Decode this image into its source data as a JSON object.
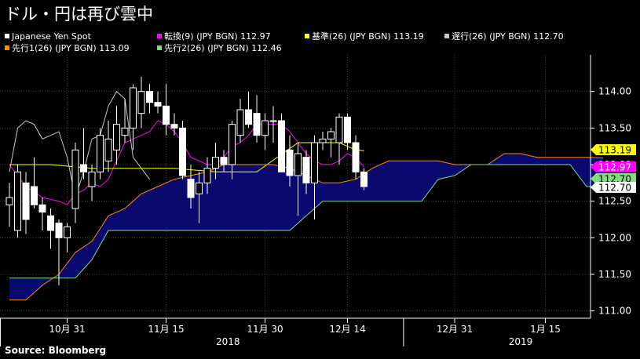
{
  "title": "ドル・円は再び雲中",
  "source": "Source: Bloomberg",
  "legend": [
    {
      "key": "spot",
      "label": "Japanese Yen Spot",
      "color": "#ffffff"
    },
    {
      "key": "tenkan",
      "label": "転換(9) (JPY BGN)    112.97",
      "color": "#ff00ff"
    },
    {
      "key": "kijun",
      "label": "基準(26) (JPY BGN) 113.19",
      "color": "#ffff00"
    },
    {
      "key": "chikou",
      "label": "遅行(26) (JPY BGN) 112.70",
      "color": "#c8c8c8"
    },
    {
      "key": "senkou1",
      "label": "先行1(26) (JPY BGN) 113.09",
      "color": "#ff8c00"
    },
    {
      "key": "senkou2",
      "label": "先行2(26) (JPY BGN) 112.46",
      "color": "#7fdc7f"
    }
  ],
  "chart_data": {
    "type": "candlestick",
    "title": "ドル・円は再び雲中",
    "ylim": [
      110.9,
      114.5
    ],
    "y_ticks": [
      "111.00",
      "111.50",
      "112.00",
      "112.50",
      "113.00",
      "113.50",
      "114.00"
    ],
    "x_tick_labels": [
      "10月 31",
      "11月 15",
      "11月 30",
      "12月 14",
      "12月 31",
      "1月 15"
    ],
    "x_period_labels": [
      "2018",
      "2019"
    ],
    "cloud_color": "#0a0a6e",
    "last_value_tags": [
      {
        "series": "kijun",
        "value": "113.19",
        "bg": "#ffff00",
        "fg": "#000000"
      },
      {
        "series": "tenkan",
        "value": "112.97",
        "bg": "#ff00ff",
        "fg": "#ffffff"
      },
      {
        "series": "senkou2",
        "value": "112.70",
        "bg": "#7fdc7f",
        "fg": "#000000"
      },
      {
        "series": "chikou",
        "value": "112.70",
        "bg": "#ffffff",
        "fg": "#000000"
      }
    ],
    "candles": [
      {
        "i": 0,
        "o": 112.45,
        "h": 112.75,
        "l": 112.15,
        "c": 112.55
      },
      {
        "i": 1,
        "o": 112.1,
        "h": 113.0,
        "l": 112.0,
        "c": 112.9
      },
      {
        "i": 2,
        "o": 112.75,
        "h": 112.9,
        "l": 112.05,
        "c": 112.25
      },
      {
        "i": 3,
        "o": 112.7,
        "h": 113.1,
        "l": 112.4,
        "c": 112.45
      },
      {
        "i": 4,
        "o": 112.45,
        "h": 112.55,
        "l": 112.1,
        "c": 112.35
      },
      {
        "i": 5,
        "o": 112.3,
        "h": 112.4,
        "l": 111.85,
        "c": 112.1
      },
      {
        "i": 6,
        "o": 112.2,
        "h": 112.25,
        "l": 111.35,
        "c": 112.0
      },
      {
        "i": 7,
        "o": 112.0,
        "h": 112.2,
        "l": 111.8,
        "c": 112.15
      },
      {
        "i": 8,
        "o": 112.4,
        "h": 113.3,
        "l": 112.2,
        "c": 113.2
      },
      {
        "i": 9,
        "o": 113.0,
        "h": 113.5,
        "l": 112.8,
        "c": 112.9
      },
      {
        "i": 10,
        "o": 112.7,
        "h": 113.0,
        "l": 112.5,
        "c": 112.9
      },
      {
        "i": 11,
        "o": 112.9,
        "h": 113.5,
        "l": 112.8,
        "c": 113.4
      },
      {
        "i": 12,
        "o": 113.05,
        "h": 113.6,
        "l": 112.9,
        "c": 113.35
      },
      {
        "i": 13,
        "o": 113.2,
        "h": 113.8,
        "l": 113.0,
        "c": 113.55
      },
      {
        "i": 14,
        "o": 113.4,
        "h": 113.9,
        "l": 113.3,
        "c": 113.5
      },
      {
        "i": 15,
        "o": 113.5,
        "h": 114.1,
        "l": 113.2,
        "c": 114.05
      },
      {
        "i": 16,
        "o": 113.7,
        "h": 114.2,
        "l": 113.5,
        "c": 114.0
      },
      {
        "i": 17,
        "o": 114.0,
        "h": 114.1,
        "l": 113.7,
        "c": 113.85
      },
      {
        "i": 18,
        "o": 113.85,
        "h": 114.0,
        "l": 113.7,
        "c": 113.8
      },
      {
        "i": 19,
        "o": 113.8,
        "h": 114.1,
        "l": 113.4,
        "c": 113.55
      },
      {
        "i": 20,
        "o": 113.55,
        "h": 113.7,
        "l": 113.4,
        "c": 113.5
      },
      {
        "i": 21,
        "o": 113.5,
        "h": 113.6,
        "l": 112.8,
        "c": 112.85
      },
      {
        "i": 22,
        "o": 112.8,
        "h": 113.0,
        "l": 112.4,
        "c": 112.55
      },
      {
        "i": 23,
        "o": 112.6,
        "h": 112.9,
        "l": 112.2,
        "c": 112.75
      },
      {
        "i": 24,
        "o": 112.75,
        "h": 113.1,
        "l": 112.6,
        "c": 112.95
      },
      {
        "i": 25,
        "o": 112.95,
        "h": 113.3,
        "l": 112.8,
        "c": 113.1
      },
      {
        "i": 26,
        "o": 113.1,
        "h": 113.2,
        "l": 112.9,
        "c": 113.0
      },
      {
        "i": 27,
        "o": 113.0,
        "h": 113.6,
        "l": 112.8,
        "c": 113.55
      },
      {
        "i": 28,
        "o": 113.4,
        "h": 113.9,
        "l": 113.3,
        "c": 113.75
      },
      {
        "i": 29,
        "o": 113.75,
        "h": 114.0,
        "l": 113.5,
        "c": 113.55
      },
      {
        "i": 30,
        "o": 113.7,
        "h": 113.95,
        "l": 113.3,
        "c": 113.4
      },
      {
        "i": 31,
        "o": 113.4,
        "h": 113.7,
        "l": 113.2,
        "c": 113.6
      },
      {
        "i": 32,
        "o": 113.6,
        "h": 113.8,
        "l": 113.3,
        "c": 113.6
      },
      {
        "i": 33,
        "o": 113.6,
        "h": 113.7,
        "l": 113.0,
        "c": 112.9
      },
      {
        "i": 34,
        "o": 113.2,
        "h": 113.4,
        "l": 112.7,
        "c": 112.85
      },
      {
        "i": 35,
        "o": 112.85,
        "h": 113.3,
        "l": 112.3,
        "c": 113.15
      },
      {
        "i": 36,
        "o": 113.1,
        "h": 113.2,
        "l": 112.6,
        "c": 112.75
      },
      {
        "i": 37,
        "o": 112.75,
        "h": 113.4,
        "l": 112.25,
        "c": 113.3
      },
      {
        "i": 38,
        "o": 113.3,
        "h": 113.45,
        "l": 113.2,
        "c": 113.35
      },
      {
        "i": 39,
        "o": 113.35,
        "h": 113.5,
        "l": 113.1,
        "c": 113.45
      },
      {
        "i": 40,
        "o": 113.3,
        "h": 113.7,
        "l": 113.0,
        "c": 113.65
      },
      {
        "i": 41,
        "o": 113.65,
        "h": 113.7,
        "l": 113.2,
        "c": 113.3
      },
      {
        "i": 42,
        "o": 113.3,
        "h": 113.4,
        "l": 112.8,
        "c": 112.9
      },
      {
        "i": 43,
        "o": 112.9,
        "h": 112.95,
        "l": 112.65,
        "c": 112.7
      }
    ],
    "series": [
      {
        "name": "転換(9) (JPY BGN)",
        "key": "tenkan",
        "color": "#ff00ff",
        "x": [
          0,
          2,
          4,
          6,
          7,
          8,
          9,
          10,
          11,
          12,
          13,
          14,
          15,
          16,
          17,
          18,
          19,
          20,
          21,
          22,
          23,
          24,
          25,
          26,
          27,
          28,
          29,
          30,
          31,
          32,
          33,
          34,
          35,
          36,
          37,
          38,
          39,
          40,
          41,
          42,
          43
        ],
        "y": [
          113.0,
          112.7,
          112.55,
          112.5,
          112.45,
          112.6,
          112.65,
          112.75,
          112.7,
          112.8,
          113.05,
          113.3,
          113.35,
          113.4,
          113.45,
          113.6,
          113.55,
          113.45,
          113.3,
          113.1,
          113.05,
          113.0,
          113.0,
          113.1,
          113.25,
          113.3,
          113.4,
          113.55,
          113.55,
          113.55,
          113.55,
          113.45,
          113.3,
          113.15,
          113.05,
          113.0,
          113.0,
          113.05,
          113.15,
          113.1,
          112.97
        ]
      },
      {
        "name": "基準(26) (JPY BGN)",
        "key": "kijun",
        "color": "#ffff00",
        "x": [
          0,
          5,
          10,
          15,
          20,
          25,
          30,
          35,
          36,
          37,
          38,
          39,
          40,
          41,
          42,
          43
        ],
        "y": [
          113.0,
          113.0,
          112.95,
          112.95,
          112.95,
          112.9,
          112.9,
          113.3,
          113.3,
          113.3,
          113.3,
          113.3,
          113.3,
          113.25,
          113.2,
          113.19
        ]
      },
      {
        "name": "遅行(26) (JPY BGN)",
        "key": "chikou",
        "color": "#c8c8c8",
        "x": [
          0,
          1,
          2,
          3,
          4,
          5,
          6,
          7,
          8,
          9,
          10,
          11,
          12,
          13,
          14,
          15,
          16,
          17
        ],
        "y": [
          112.9,
          113.5,
          113.6,
          113.55,
          113.35,
          113.4,
          113.45,
          113.1,
          112.55,
          112.9,
          113.35,
          113.4,
          113.8,
          114.0,
          113.9,
          113.1,
          112.95,
          112.8
        ]
      },
      {
        "name": "先行1(26) (JPY BGN)",
        "key": "senkou1",
        "color": "#ff8c00",
        "x": [
          0,
          2,
          4,
          6,
          8,
          10,
          12,
          14,
          16,
          18,
          20,
          22,
          24,
          26,
          28,
          30,
          32,
          34,
          36,
          38,
          40,
          42,
          44,
          46,
          48,
          50,
          52,
          54,
          56,
          58,
          60,
          62,
          64,
          66,
          68,
          70,
          72
        ],
        "y": [
          111.15,
          111.15,
          111.35,
          111.5,
          111.8,
          111.95,
          112.3,
          112.4,
          112.6,
          112.7,
          112.8,
          112.85,
          112.9,
          113.0,
          113.0,
          113.0,
          113.0,
          112.95,
          112.85,
          112.75,
          112.75,
          112.8,
          112.95,
          113.05,
          113.05,
          113.05,
          113.05,
          113.0,
          113.0,
          113.0,
          113.15,
          113.15,
          113.1,
          113.1,
          113.1,
          113.1,
          113.09
        ]
      },
      {
        "name": "先行2(26) (JPY BGN)",
        "key": "senkou2",
        "color": "#7fdc7f",
        "x": [
          0,
          2,
          4,
          6,
          8,
          10,
          12,
          14,
          16,
          18,
          20,
          22,
          24,
          26,
          28,
          30,
          32,
          34,
          36,
          38,
          40,
          42,
          44,
          46,
          48,
          50,
          52,
          54,
          56,
          58,
          60,
          62,
          64,
          66,
          68,
          70,
          72
        ],
        "y": [
          111.45,
          111.45,
          111.45,
          111.45,
          111.45,
          111.7,
          112.1,
          112.1,
          112.1,
          112.1,
          112.1,
          112.1,
          112.1,
          112.1,
          112.1,
          112.1,
          112.1,
          112.1,
          112.3,
          112.5,
          112.5,
          112.5,
          112.5,
          112.5,
          112.5,
          112.5,
          112.8,
          112.85,
          113.0,
          113.0,
          113.0,
          113.0,
          113.0,
          113.0,
          113.0,
          112.7,
          112.7
        ]
      }
    ]
  }
}
